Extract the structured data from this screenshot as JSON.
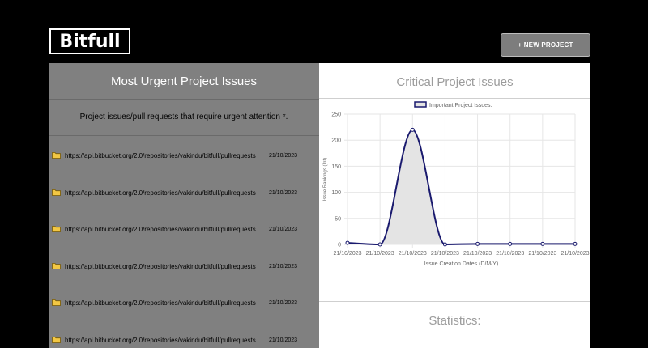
{
  "header": {
    "logo": "Bitfull",
    "new_project_label": "+ NEW PROJECT"
  },
  "urgent": {
    "title": "Most Urgent Project Issues",
    "subtitle": "Project issues/pull requests that require urgent attention *.",
    "items": [
      {
        "url": "https://api.bitbucket.org/2.0/repositories/vakindu/bitfull/pullrequests",
        "date": "21/10/2023"
      },
      {
        "url": "https://api.bitbucket.org/2.0/repositories/vakindu/bitfull/pullrequests",
        "date": "21/10/2023"
      },
      {
        "url": "https://api.bitbucket.org/2.0/repositories/vakindu/bitfull/pullrequests",
        "date": "21/10/2023"
      },
      {
        "url": "https://api.bitbucket.org/2.0/repositories/vakindu/bitfull/pullrequests",
        "date": "21/10/2023"
      },
      {
        "url": "https://api.bitbucket.org/2.0/repositories/vakindu/bitfull/pullrequests",
        "date": "21/10/2023"
      },
      {
        "url": "https://api.bitbucket.org/2.0/repositories/vakindu/bitfull/pullrequests",
        "date": "21/10/2023"
      }
    ]
  },
  "critical": {
    "title": "Critical Project Issues"
  },
  "statistics": {
    "title": "Statistics:"
  },
  "chart_data": {
    "type": "area",
    "categories": [
      "21/10/2023",
      "21/10/2023",
      "21/10/2023",
      "21/10/2023",
      "21/10/2023",
      "21/10/2023",
      "21/10/2023",
      "21/10/2023"
    ],
    "series": [
      {
        "name": "Important Project Issues.",
        "values": [
          3,
          0,
          220,
          0,
          1,
          1,
          1,
          1
        ]
      }
    ],
    "xlabel": "Issue Creation Dates (D/M/Y)",
    "ylabel": "Issue Rankings (Int)",
    "ylim": [
      0,
      250
    ],
    "yticks": [
      0,
      50,
      100,
      150,
      200,
      250
    ],
    "grid": true,
    "legend": "top-center",
    "colors": {
      "line": "#1a1a6e",
      "fill": "#e4e4e4",
      "grid": "#e6e6e6"
    }
  }
}
